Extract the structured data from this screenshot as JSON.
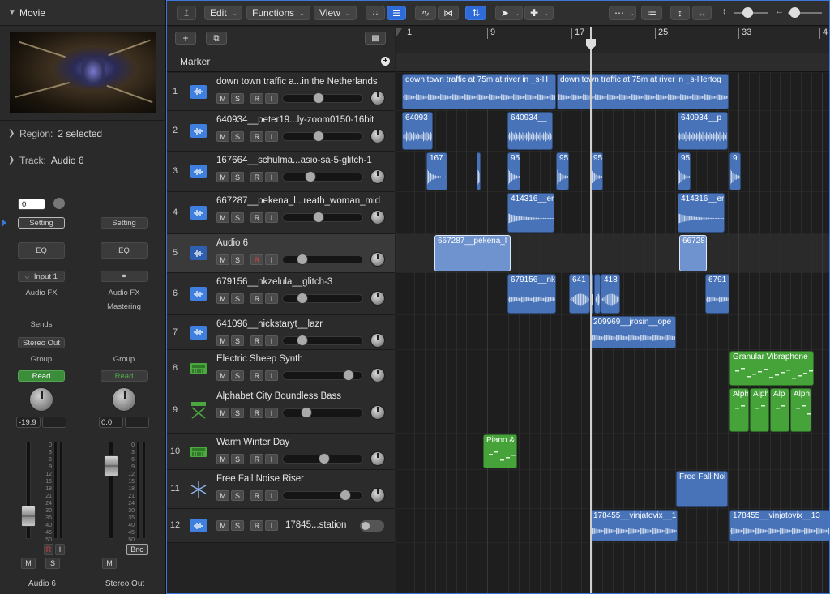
{
  "inspector": {
    "movie_label": "Movie",
    "region_label": "Region:",
    "region_value": "2 selected",
    "track_label": "Track:",
    "track_value": "Audio 6",
    "strip1": {
      "value_display": "0",
      "setting": "Setting",
      "eq": "EQ",
      "input": "Input 1",
      "audio_fx": "Audio FX",
      "sends": "Sends",
      "output": "Stereo Out",
      "group": "Group",
      "automation": "Read",
      "volume": "-19.9",
      "mute": "M",
      "solo": "S",
      "rec": "R",
      "input_mon": "I",
      "name": "Audio 6"
    },
    "strip2": {
      "setting": "Setting",
      "eq": "EQ",
      "audio_fx": "Audio FX",
      "mastering": "Mastering",
      "group": "Group",
      "automation": "Read",
      "volume": "0.0",
      "bounce": "Bnc",
      "mute": "M",
      "name": "Stereo Out"
    },
    "meter_scale": [
      "0",
      "3",
      "6",
      "9",
      "12",
      "15",
      "18",
      "21",
      "24",
      "30",
      "35",
      "40",
      "45",
      "50",
      "60"
    ]
  },
  "toolbar": {
    "edit": "Edit",
    "functions": "Functions",
    "view": "View"
  },
  "header": {
    "marker": "Marker",
    "ruler_bars": [
      "1",
      "9",
      "17",
      "25",
      "33",
      "4"
    ]
  },
  "tracks": [
    {
      "num": "1",
      "name": "down town traffic a...in the Netherlands",
      "type": "audio"
    },
    {
      "num": "2",
      "name": "640934__peter19...ly-zoom0150-16bit",
      "type": "audio"
    },
    {
      "num": "3",
      "name": "167664__schulma...asio-sa-5-glitch-1",
      "type": "audio"
    },
    {
      "num": "4",
      "name": "667287__pekena_l...reath_woman_mid",
      "type": "audio"
    },
    {
      "num": "5",
      "name": "Audio 6",
      "type": "audio"
    },
    {
      "num": "6",
      "name": "679156__nkzelula__glitch-3",
      "type": "audio"
    },
    {
      "num": "7",
      "name": "641096__nickstaryt__lazr",
      "type": "audio"
    },
    {
      "num": "8",
      "name": "Electric Sheep Synth",
      "type": "synth"
    },
    {
      "num": "9",
      "name": "Alphabet City Boundless Bass",
      "type": "bass"
    },
    {
      "num": "10",
      "name": "Warm Winter Day",
      "type": "synth"
    },
    {
      "num": "11",
      "name": "Free Fall Noise Riser",
      "type": "riser"
    },
    {
      "num": "12",
      "name": "17845...station",
      "type": "audio"
    }
  ],
  "msri": {
    "m": "M",
    "s": "S",
    "r": "R",
    "i": "I"
  },
  "regions": {
    "r1a": "down town traffic at 75m at river in _s-H",
    "r1b": "down town traffic at 75m at river in _s-Hertog",
    "r2a": "64093",
    "r2b": "640934__",
    "r2c": "640934__p",
    "r3a": "167",
    "r3b": "95",
    "r3c": "95",
    "r3d": "95",
    "r3e": "95",
    "r3f": "9",
    "r4a": "414316__er",
    "r4b": "414316__er",
    "r5a": "667287__pekena_l",
    "r5b": "66728",
    "r6a": "679156__nk",
    "r6b": "641",
    "r6c": "418",
    "r6d": "6791",
    "r7a": "209969__jrosin__ope",
    "r8a": "Granular Vibraphone",
    "r9a": "Alph",
    "r9b": "Alph",
    "r9c": "Alp",
    "r9d": "Alph",
    "r10a": "Piano &",
    "r11a": "Free Fall Noi",
    "r12a": "178455__vinjatovix__1",
    "r12b": "178455__vinjatovix__13"
  }
}
